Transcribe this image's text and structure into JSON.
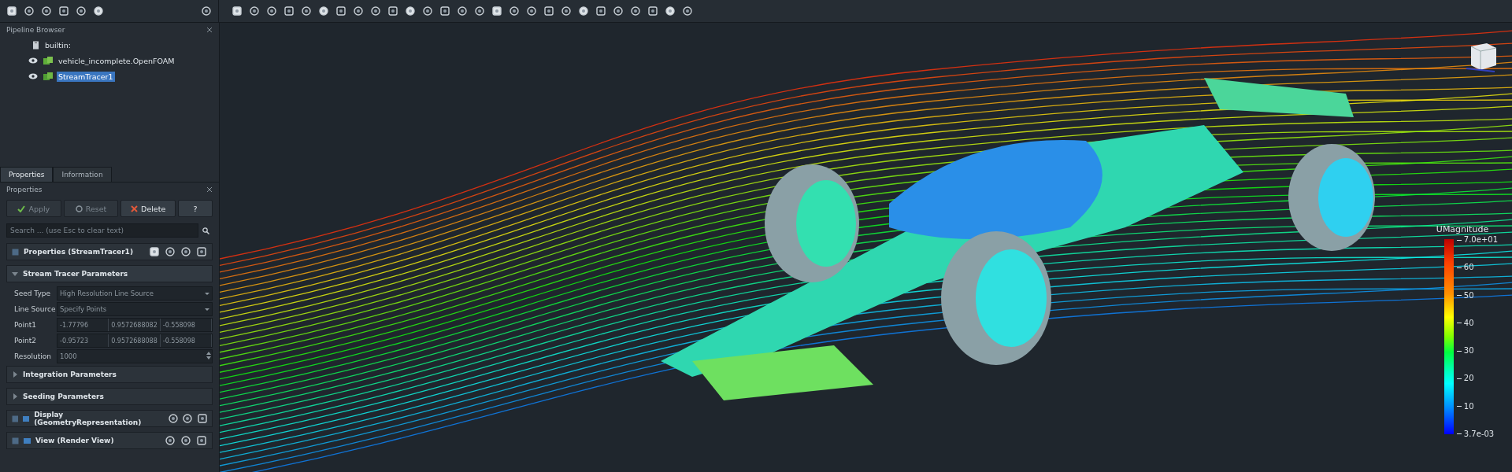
{
  "pipeline_browser": {
    "title": "Pipeline Browser",
    "items": [
      {
        "label": "builtin:",
        "kind": "server",
        "selected": false,
        "children": [
          {
            "label": "vehicle_incomplete.OpenFOAM",
            "kind": "source",
            "visible": true,
            "selected": false
          },
          {
            "label": "StreamTracer1",
            "kind": "filter",
            "visible": true,
            "selected": true
          }
        ]
      }
    ]
  },
  "tabs": [
    {
      "label": "Properties",
      "selected": true
    },
    {
      "label": "Information",
      "selected": false
    }
  ],
  "properties_panel": {
    "title": "Properties",
    "buttons": [
      {
        "label": "Apply",
        "kind": "apply",
        "disabled": true
      },
      {
        "label": "Reset",
        "kind": "reset",
        "disabled": true
      },
      {
        "label": "Delete",
        "kind": "delete",
        "disabled": false
      },
      {
        "label": "?",
        "kind": "help",
        "disabled": false
      }
    ],
    "search": {
      "placeholder": "Search ... (use Esc to clear text)"
    },
    "header": "Properties (StreamTracer1)",
    "sections": [
      {
        "title": "Stream Tracer Parameters",
        "kind": "group",
        "expanded": true,
        "fields": [
          {
            "label": "Seed Type",
            "kind": "dropdown",
            "value": "High Resolution Line Source"
          },
          {
            "label": "Line Source",
            "kind": "dropdown",
            "value": "Specify Points"
          },
          {
            "label": "Point1",
            "kind": "vector",
            "values": [
              "-1.77796",
              "0.9572688082",
              "-0.558098"
            ]
          },
          {
            "label": "Point2",
            "kind": "vector",
            "values": [
              "-0.95723",
              "0.9572688088",
              "-0.558098"
            ]
          },
          {
            "label": "Resolution",
            "kind": "spin",
            "value": "1000"
          }
        ]
      },
      {
        "title": "Integration Parameters",
        "kind": "group",
        "expanded": false
      },
      {
        "title": "Seeding Parameters",
        "kind": "group",
        "expanded": false
      },
      {
        "title": "Display (GeometryRepresentation)",
        "kind": "panel"
      },
      {
        "title": "View (Render View)",
        "kind": "panel"
      }
    ]
  },
  "color_legend": {
    "title": "UMagnitude",
    "labels": [
      "7.0e+01",
      "60",
      "50",
      "40",
      "30",
      "20",
      "10",
      "3.7e-03"
    ]
  }
}
